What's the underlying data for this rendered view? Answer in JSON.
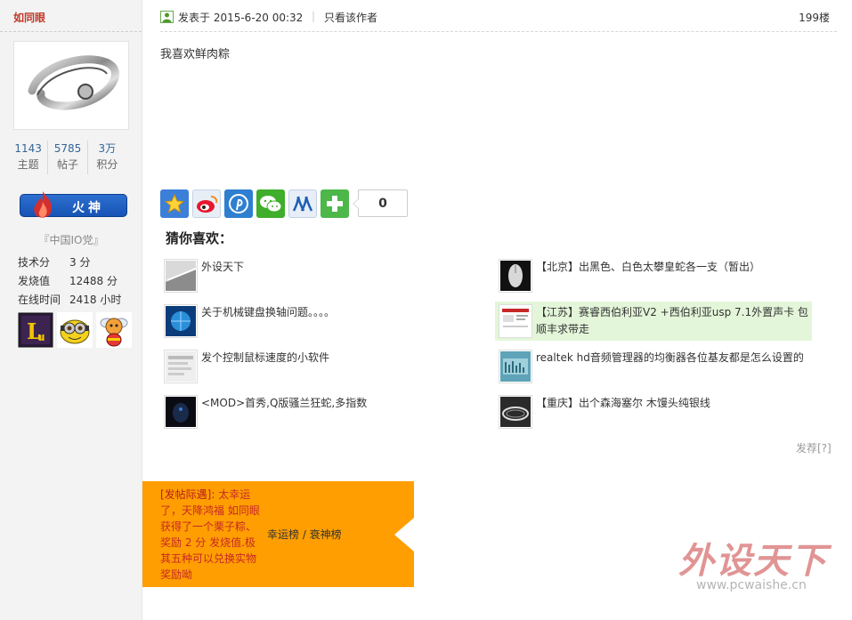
{
  "author": {
    "username": "如同眼",
    "stats": [
      {
        "value": "1143",
        "label": "主题"
      },
      {
        "value": "5785",
        "label": "帖子"
      },
      {
        "value": "3万",
        "label": "积分"
      }
    ],
    "rank": "火神",
    "group": "『中国IO党』",
    "info": [
      {
        "key": "技术分",
        "value": "3 分"
      },
      {
        "key": "发烧值",
        "value": "12488 分"
      },
      {
        "key": "在线时间",
        "value": "2418 小时"
      }
    ]
  },
  "post": {
    "time": "发表于 2015-6-20 00:32",
    "only_author": "只看该作者",
    "floor": "199楼",
    "body": "我喜欢鲜肉粽"
  },
  "share": {
    "count": "0",
    "icons": [
      "favorite-star-icon",
      "weibo-icon",
      "pinterest-icon",
      "wechat-icon",
      "renren-icon",
      "plus-icon"
    ]
  },
  "guess": {
    "title": "猜你喜欢：",
    "items": [
      {
        "text": "外设天下"
      },
      {
        "text": "【北京】出黑色、白色太攀皇蛇各一支（暂出）"
      },
      {
        "text": "关于机械键盘换轴问题。。。。"
      },
      {
        "text": "【江苏】赛睿西伯利亚V2 +西伯利亚usp 7.1外置声卡 包顺丰求带走"
      },
      {
        "text": "发个控制鼠标速度的小软件"
      },
      {
        "text": "realtek hd音频管理器的均衡器各位基友都是怎么设置的"
      },
      {
        "text": "<MOD>首秀,Q版骚兰狂蛇,多指数"
      },
      {
        "text": "【重庆】出个森海塞尔 木馒头纯银线"
      }
    ],
    "recommend": "发荐[?]"
  },
  "luck": {
    "tag": "[发帖际遇]:",
    "text": " 太幸运了，天降鸿福 如同眼获得了一个栗子粽、奖励 2 分 发烧值.极其五种可以兑换实物奖励呦",
    "links": "幸运榜 / 衰神榜"
  },
  "watermark": {
    "title": "外设天下",
    "url": "www.pcwaishe.cn"
  },
  "colors": {
    "luck_bg": "#ff9e00",
    "highlight": "#e4f6d9",
    "username": "#c0392b"
  }
}
